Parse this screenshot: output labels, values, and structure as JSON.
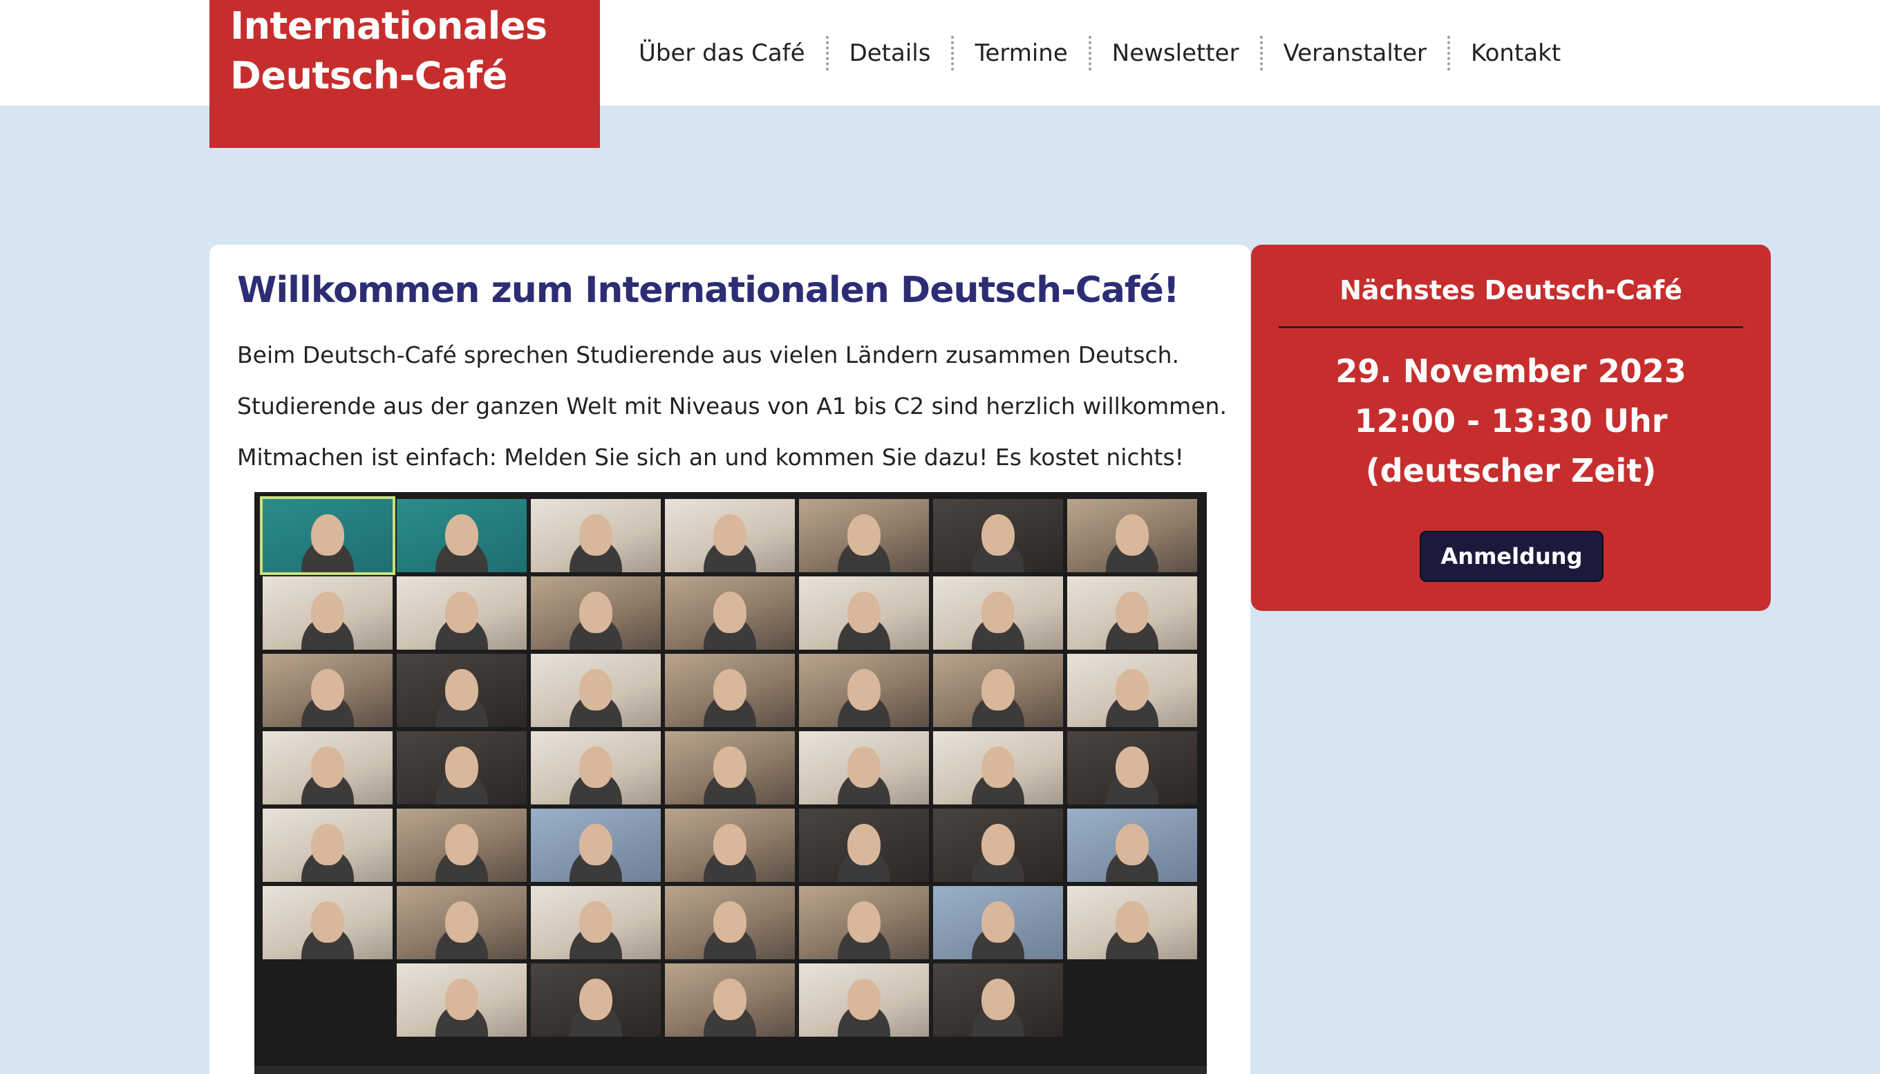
{
  "logo": {
    "line1": "Internationales",
    "line2": "Deutsch-Café"
  },
  "nav": {
    "items": [
      "Über das Café",
      "Details",
      "Termine",
      "Newsletter",
      "Veranstalter",
      "Kontakt"
    ]
  },
  "main": {
    "title": "Willkommen zum Internationalen Deutsch-Café!",
    "paragraphs": [
      "Beim Deutsch-Café sprechen Studierende aus vielen Ländern zusammen Deutsch.",
      "Studierende aus der ganzen Welt mit Niveaus von A1 bis C2 sind herzlich willkommen.",
      "Mitmachen ist einfach: Melden Sie sich an und kommen Sie dazu! Es kostet nichts!"
    ]
  },
  "side": {
    "title": "Nächstes Deutsch-Café",
    "date": "29. November 2023",
    "time": "12:00 - 13:30 Uhr",
    "timezone": "(deutscher Zeit)",
    "button_label": "Anmeldung"
  },
  "colors": {
    "brand_red": "#c62e2e",
    "heading_blue": "#2c2d74",
    "background": "#d5e5f2",
    "button_dark": "#1a1a3c"
  }
}
